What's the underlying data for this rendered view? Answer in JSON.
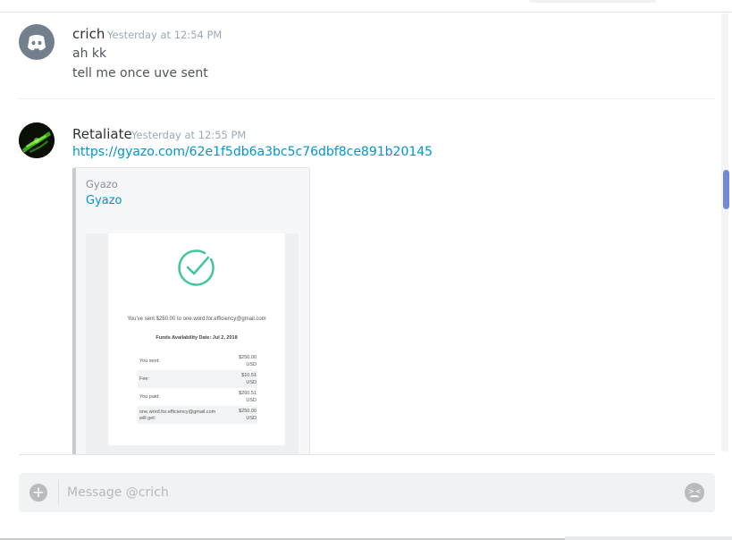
{
  "messages": [
    {
      "author": "crich",
      "timestamp": "Yesterday at 12:54 PM",
      "avatar_icon": "discord-logo-icon",
      "lines": [
        "ah kk",
        "tell me once uve sent"
      ]
    },
    {
      "author": "Retaliate",
      "timestamp": "Yesterday at 12:55 PM",
      "avatar_icon": "green-abstract-avatar",
      "link": "https://gyazo.com/62e1f5db6a3bc5c76dbf8ce891b20145",
      "embed": {
        "provider": "Gyazo",
        "title": "Gyazo",
        "image": {
          "sent_text": "You've sent $250.00 to one.word.for.efficiency@gmail.com",
          "availability": "Funds Availability Date: Jul 2, 2018",
          "rows": [
            {
              "label": "You sent:",
              "amount": "$250.00",
              "currency": "USD"
            },
            {
              "label": "Fee:",
              "amount": "$10.51",
              "currency": "USD"
            },
            {
              "label": "You paid:",
              "amount": "$260.51",
              "currency": "USD"
            },
            {
              "label": "one.word.for.efficiency@gmail.com will get:",
              "amount": "$250.00",
              "currency": "USD"
            }
          ]
        }
      }
    }
  ],
  "composer": {
    "placeholder": "Message @crich",
    "value": ""
  },
  "colors": {
    "link": "#0096cf",
    "accent": "#7289da",
    "check": "#43c59e",
    "receipt_button": "#0c7fc2"
  }
}
